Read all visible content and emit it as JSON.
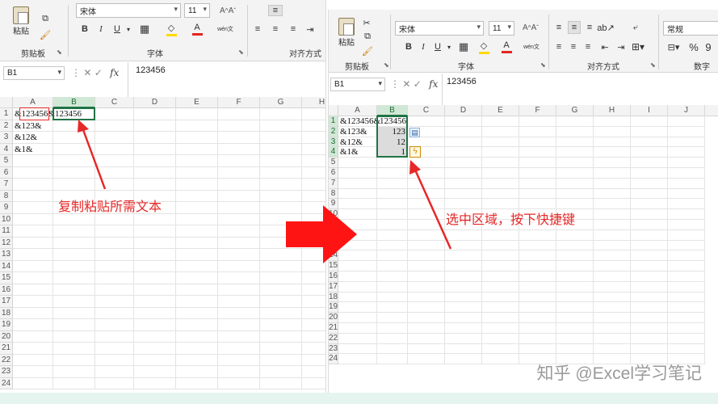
{
  "left": {
    "ribbon": {
      "paste_label": "粘贴",
      "clipboard_label": "剪贴板",
      "font_group_label": "字体",
      "align_group_label": "对齐方式",
      "font_name": "宋体",
      "font_size": "11",
      "bold": "B",
      "italic": "I",
      "underline": "U",
      "phonetic": "wén文"
    },
    "formula_bar": {
      "name_box": "B1",
      "fx": "fx",
      "formula": "123456"
    },
    "grid": {
      "columns": [
        "A",
        "B",
        "C",
        "D",
        "E",
        "F",
        "G",
        "H"
      ],
      "rows": [
        "1",
        "2",
        "3",
        "4",
        "5",
        "6",
        "7",
        "8",
        "9",
        "10",
        "11",
        "12",
        "13",
        "14",
        "15",
        "16",
        "17",
        "18",
        "19",
        "20",
        "21",
        "22",
        "23",
        "24"
      ],
      "cells": {
        "a1": "&123456&",
        "b1": "123456",
        "a2": "&123&",
        "a3": "&12&",
        "a4": "&1&"
      }
    },
    "annotation": "复制粘贴所需文本"
  },
  "right": {
    "ribbon": {
      "paste_label": "粘贴",
      "clipboard_label": "剪贴板",
      "font_group_label": "字体",
      "align_group_label": "对齐方式",
      "number_group_label": "数字",
      "font_name": "宋体",
      "font_size": "11",
      "number_format": "常规",
      "bold": "B",
      "italic": "I",
      "underline": "U",
      "phonetic": "wén文",
      "percent": "%",
      "comma": "9"
    },
    "formula_bar": {
      "name_box": "B1",
      "fx": "fx",
      "formula": "123456"
    },
    "grid": {
      "columns": [
        "A",
        "B",
        "C",
        "D",
        "E",
        "F",
        "G",
        "H",
        "I",
        "J"
      ],
      "rows": [
        "1",
        "2",
        "3",
        "4",
        "5",
        "6",
        "7",
        "8",
        "9",
        "10",
        "11",
        "12",
        "13",
        "14",
        "15",
        "16",
        "17",
        "18",
        "19",
        "20",
        "21",
        "22",
        "23",
        "24"
      ],
      "cells": {
        "a1": "&123456&",
        "b1": "123456",
        "a2": "&123&",
        "b2": "123",
        "a3": "&12&",
        "b3": "12",
        "a4": "&1&",
        "b4": "1"
      }
    },
    "annotation": "选中区域，按下快捷键"
  },
  "watermark": "知乎 @Excel学习笔记",
  "colors": {
    "accent_green": "#217346",
    "arrow_red": "#ff1414",
    "annotation_red": "#e62828",
    "selection_fill": "#dcdcdc"
  },
  "icons": [
    "paste-icon",
    "cut-icon",
    "copy-icon",
    "format-painter-icon",
    "borders-icon",
    "fill-color-icon",
    "font-color-icon",
    "align-icon",
    "wrap-text-icon",
    "merge-icon",
    "quick-analysis-icon",
    "flash-fill-icon",
    "big-right-arrow",
    "pointer-arrow"
  ]
}
